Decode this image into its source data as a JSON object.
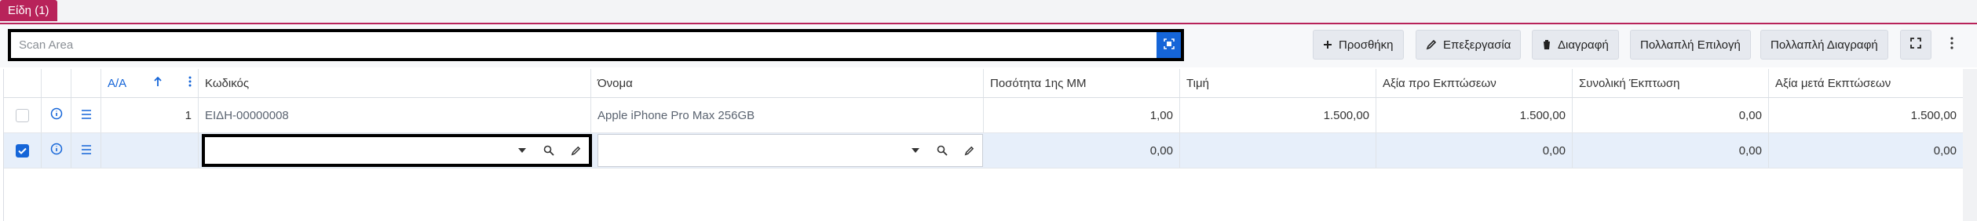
{
  "tab": {
    "label": "Είδη (1)"
  },
  "scan": {
    "placeholder": "Scan Area"
  },
  "toolbar": {
    "add": "Προσθήκη",
    "edit": "Επεξεργασία",
    "delete": "Διαγραφή",
    "multi_select": "Πολλαπλή Επιλογή",
    "multi_delete": "Πολλαπλή Διαγραφή"
  },
  "columns": {
    "aa": "Α/Α",
    "code": "Κωδικός",
    "name": "Όνομα",
    "qty": "Ποσότητα 1ης ΜΜ",
    "price": "Τιμή",
    "value_before": "Αξία προ Εκπτώσεων",
    "total_discount": "Συνολική Έκπτωση",
    "value_after": "Αξία μετά Εκπτώσεων"
  },
  "rows": [
    {
      "aa": "1",
      "code": "ΕΙΔΗ-00000008",
      "name": "Apple iPhone Pro Max 256GB",
      "qty": "1,00",
      "price": "1.500,00",
      "value_before": "1.500,00",
      "total_discount": "0,00",
      "value_after": "1.500,00"
    },
    {
      "aa": "",
      "code": "",
      "name": "",
      "qty": "0,00",
      "price": "",
      "value_before": "0,00",
      "total_discount": "0,00",
      "value_after": "0,00"
    }
  ],
  "colors": {
    "accent": "#b8235a",
    "primary": "#1565d8"
  }
}
